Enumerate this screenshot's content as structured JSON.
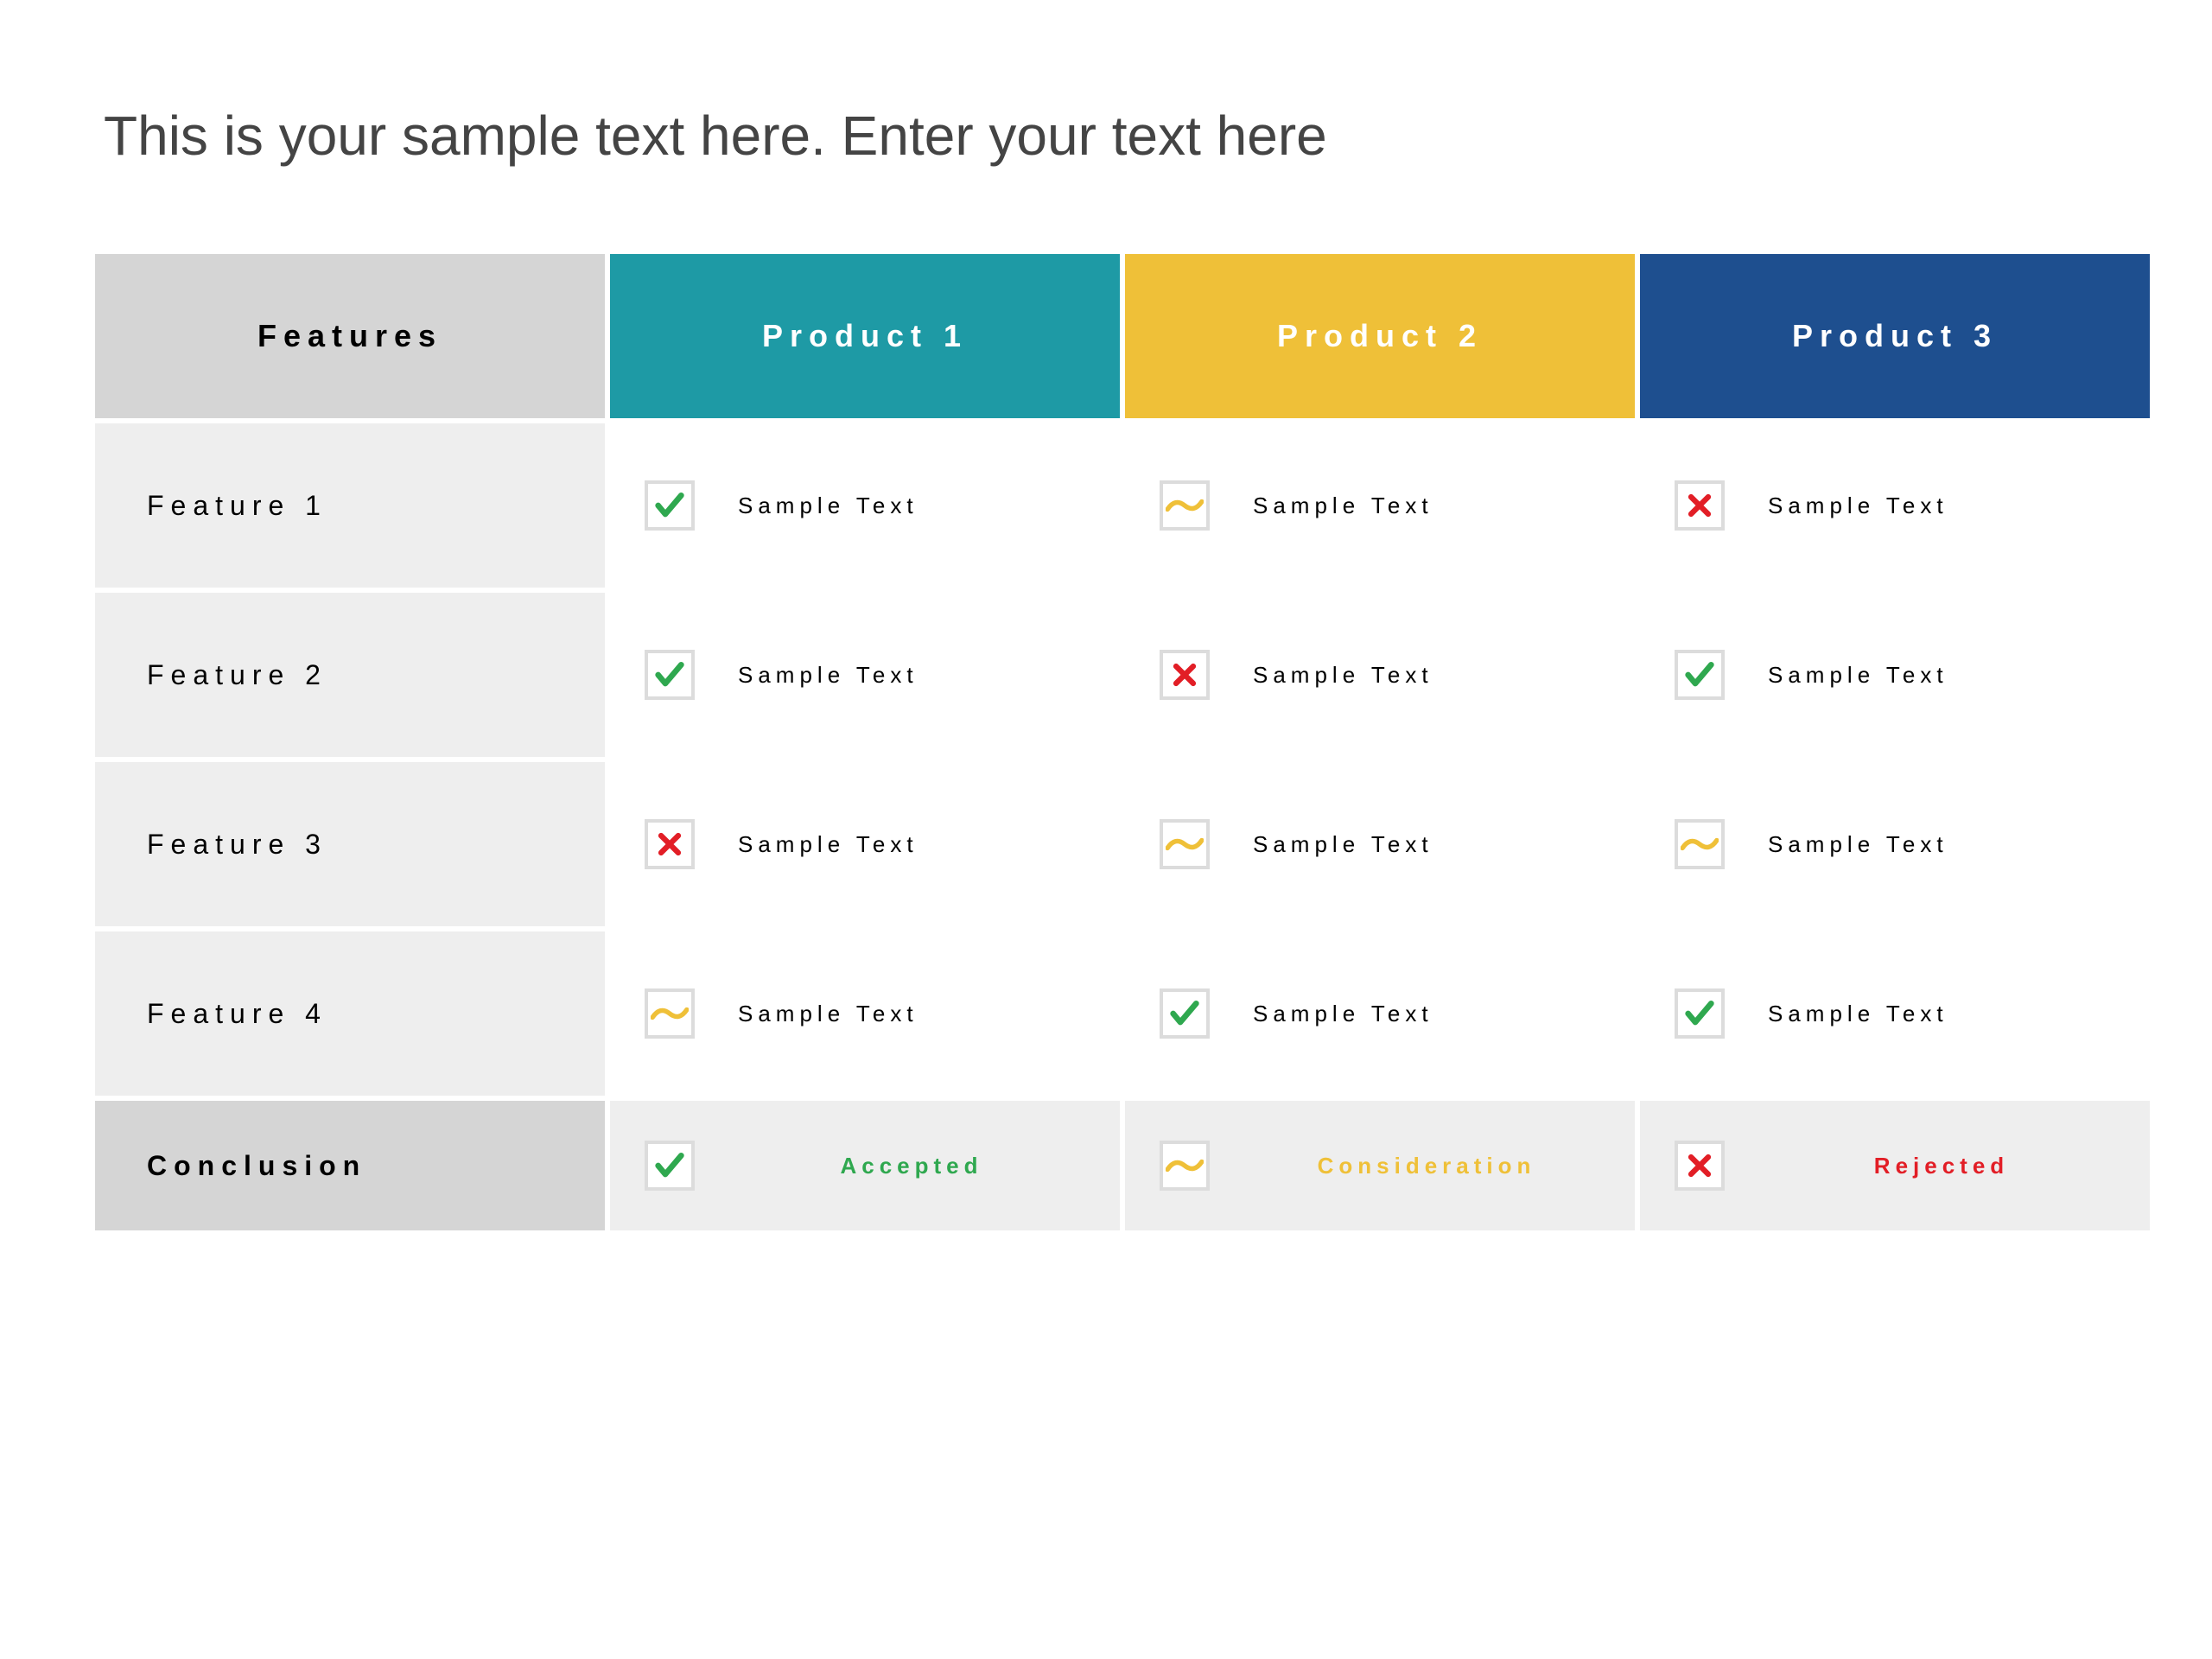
{
  "title": "This is your sample text here. Enter your text here",
  "headers": {
    "features": "Features",
    "products": [
      "Product 1",
      "Product 2",
      "Product 3"
    ]
  },
  "colors": {
    "product1": "#1e9aa5",
    "product2": "#efc038",
    "product3": "#1e4f8f",
    "check": "#2fa84f",
    "tilde": "#efc038",
    "cross": "#e21e26"
  },
  "rows": [
    {
      "label": "Feature 1",
      "cells": [
        {
          "icon": "check",
          "text": "Sample Text"
        },
        {
          "icon": "tilde",
          "text": "Sample Text"
        },
        {
          "icon": "cross",
          "text": "Sample Text"
        }
      ]
    },
    {
      "label": "Feature 2",
      "cells": [
        {
          "icon": "check",
          "text": "Sample Text"
        },
        {
          "icon": "cross",
          "text": "Sample Text"
        },
        {
          "icon": "check",
          "text": "Sample Text"
        }
      ]
    },
    {
      "label": "Feature 3",
      "cells": [
        {
          "icon": "cross",
          "text": "Sample Text"
        },
        {
          "icon": "tilde",
          "text": "Sample Text"
        },
        {
          "icon": "tilde",
          "text": "Sample Text"
        }
      ]
    },
    {
      "label": "Feature 4",
      "cells": [
        {
          "icon": "tilde",
          "text": "Sample Text"
        },
        {
          "icon": "check",
          "text": "Sample Text"
        },
        {
          "icon": "check",
          "text": "Sample Text"
        }
      ]
    }
  ],
  "conclusion": {
    "label": "Conclusion",
    "cells": [
      {
        "icon": "check",
        "text": "Accepted",
        "color": "green"
      },
      {
        "icon": "tilde",
        "text": "Consideration",
        "color": "yellow"
      },
      {
        "icon": "cross",
        "text": "Rejected",
        "color": "red"
      }
    ]
  }
}
